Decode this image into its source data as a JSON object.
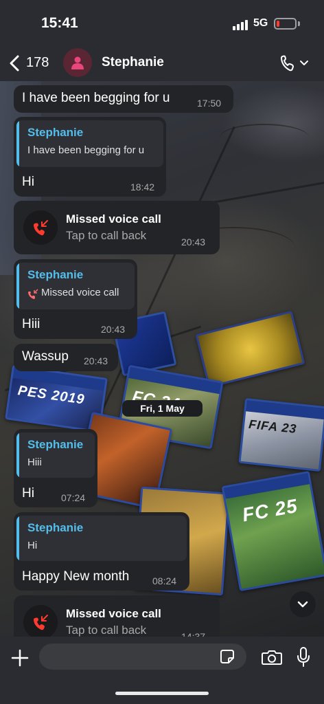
{
  "status_bar": {
    "time": "15:41",
    "network": "5G",
    "battery_level": 0.15
  },
  "header": {
    "back_count": "178",
    "contact_name": "Stephanie",
    "call_icon": "phone-icon"
  },
  "messages": [
    {
      "type": "text",
      "text": "I have been begging for u",
      "time": "17:50"
    },
    {
      "type": "reply",
      "quote_author": "Stephanie",
      "quote_text": "I have been begging for u",
      "text": "Hi",
      "time": "18:42"
    },
    {
      "type": "missed_call",
      "title": "Missed voice call",
      "subtitle": "Tap to call back",
      "time": "20:43"
    },
    {
      "type": "reply_call",
      "quote_author": "Stephanie",
      "quote_text": "Missed voice call",
      "text": "Hiii",
      "time": "20:43"
    },
    {
      "type": "text",
      "text": "Wassup",
      "time": "20:43"
    },
    {
      "type": "reply",
      "quote_author": "Stephanie",
      "quote_text": "Hiii",
      "text": "Hi",
      "time": "07:24"
    },
    {
      "type": "reply",
      "quote_author": "Stephanie",
      "quote_text": "Hi",
      "text": "Happy New month",
      "time": "08:24"
    },
    {
      "type": "missed_call",
      "title": "Missed voice call",
      "subtitle": "Tap to call back",
      "time": "14:37"
    }
  ],
  "date_separator": "Fri, 1 May",
  "composer": {
    "placeholder": ""
  },
  "colors": {
    "bubble": "#232427",
    "quote_accent": "#53bdeb",
    "missed_call_red": "#ff3b30",
    "avatar_bg": "#5a2634",
    "avatar_icon": "#e8467c"
  },
  "wallpaper_games": [
    "PES 2019",
    "FC 24",
    "FIFA 23",
    "FC 25"
  ]
}
